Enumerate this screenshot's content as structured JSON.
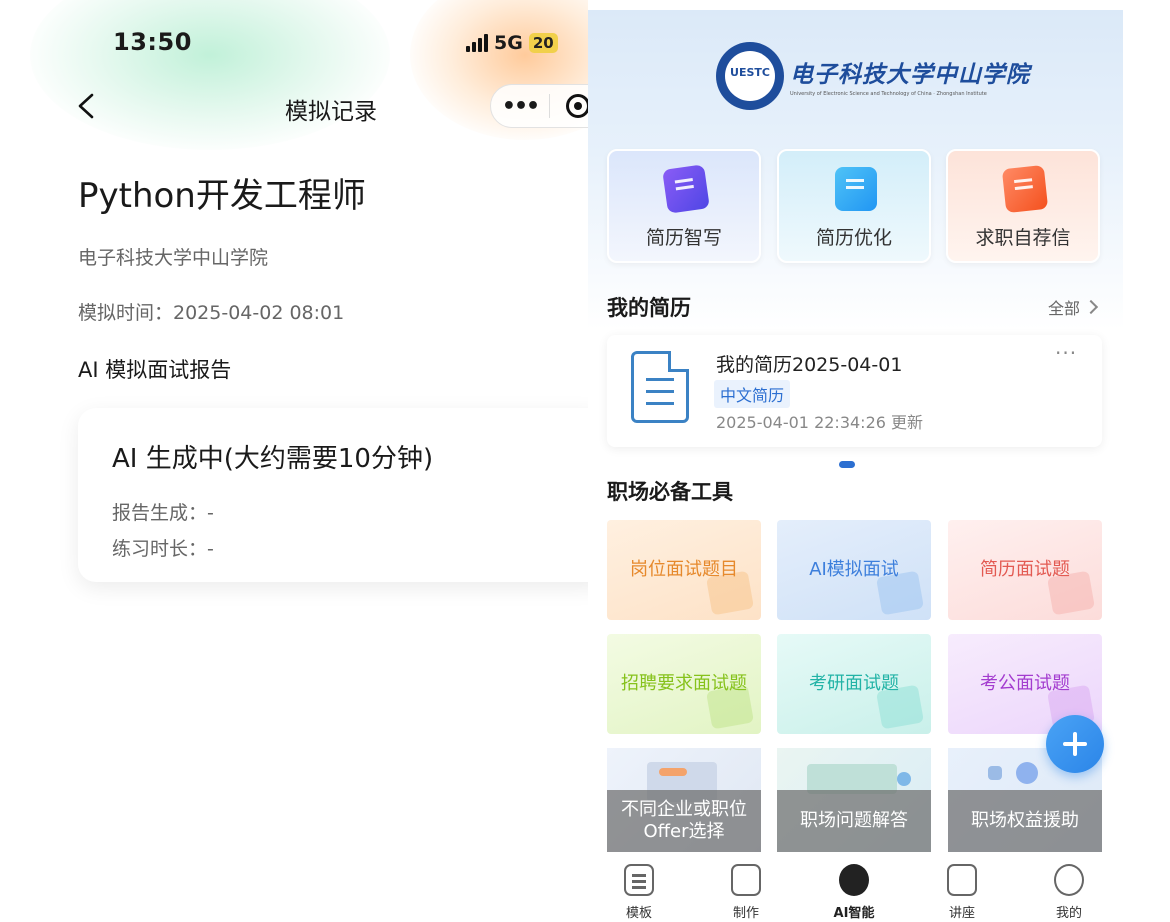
{
  "left": {
    "status_bar": {
      "time": "13:50",
      "network": "5G",
      "battery": "20"
    },
    "nav": {
      "title": "模拟记录"
    },
    "job_title": "Python开发工程师",
    "school": "电子科技大学中山学院",
    "sim_time": "模拟时间：2025-04-02 08:01",
    "report_heading": "AI 模拟面试报告",
    "report_card": {
      "title": "AI 生成中(大约需要10分钟)",
      "report_generated": "报告生成：-",
      "practice_duration": "练习时长：-"
    }
  },
  "right": {
    "logo": {
      "seal_text": "UESTC",
      "name_cn": "电子科技大学中山学院",
      "name_en": "University of Electronic Science and Technology of China · Zhongshan Institute"
    },
    "top_tools": [
      {
        "label": "简历智写",
        "icon": "resume-write-icon"
      },
      {
        "label": "简历优化",
        "icon": "resume-optimize-icon"
      },
      {
        "label": "求职自荐信",
        "icon": "cover-letter-icon"
      }
    ],
    "my_resume": {
      "title": "我的简历",
      "see_all": "全部",
      "card": {
        "name": "我的简历2025-04-01",
        "tag": "中文简历",
        "updated": "2025-04-01 22:34:26 更新",
        "more": "···"
      }
    },
    "tools": {
      "title": "职场必备工具",
      "tiles": [
        {
          "label": "岗位面试题目"
        },
        {
          "label": "AI模拟面试"
        },
        {
          "label": "简历面试题"
        },
        {
          "label": "招聘要求面试题"
        },
        {
          "label": "考研面试题"
        },
        {
          "label": "考公面试题"
        }
      ],
      "photo_tiles": [
        {
          "label": "不同企业或职位Offer选择"
        },
        {
          "label": "职场问题解答"
        },
        {
          "label": "职场权益援助"
        }
      ]
    },
    "tabbar": [
      {
        "label": "模板",
        "icon": "template-icon"
      },
      {
        "label": "制作",
        "icon": "make-icon"
      },
      {
        "label": "AI智能",
        "icon": "ai-icon",
        "active": true
      },
      {
        "label": "讲座",
        "icon": "calendar-icon"
      },
      {
        "label": "我的",
        "icon": "profile-icon"
      }
    ]
  }
}
